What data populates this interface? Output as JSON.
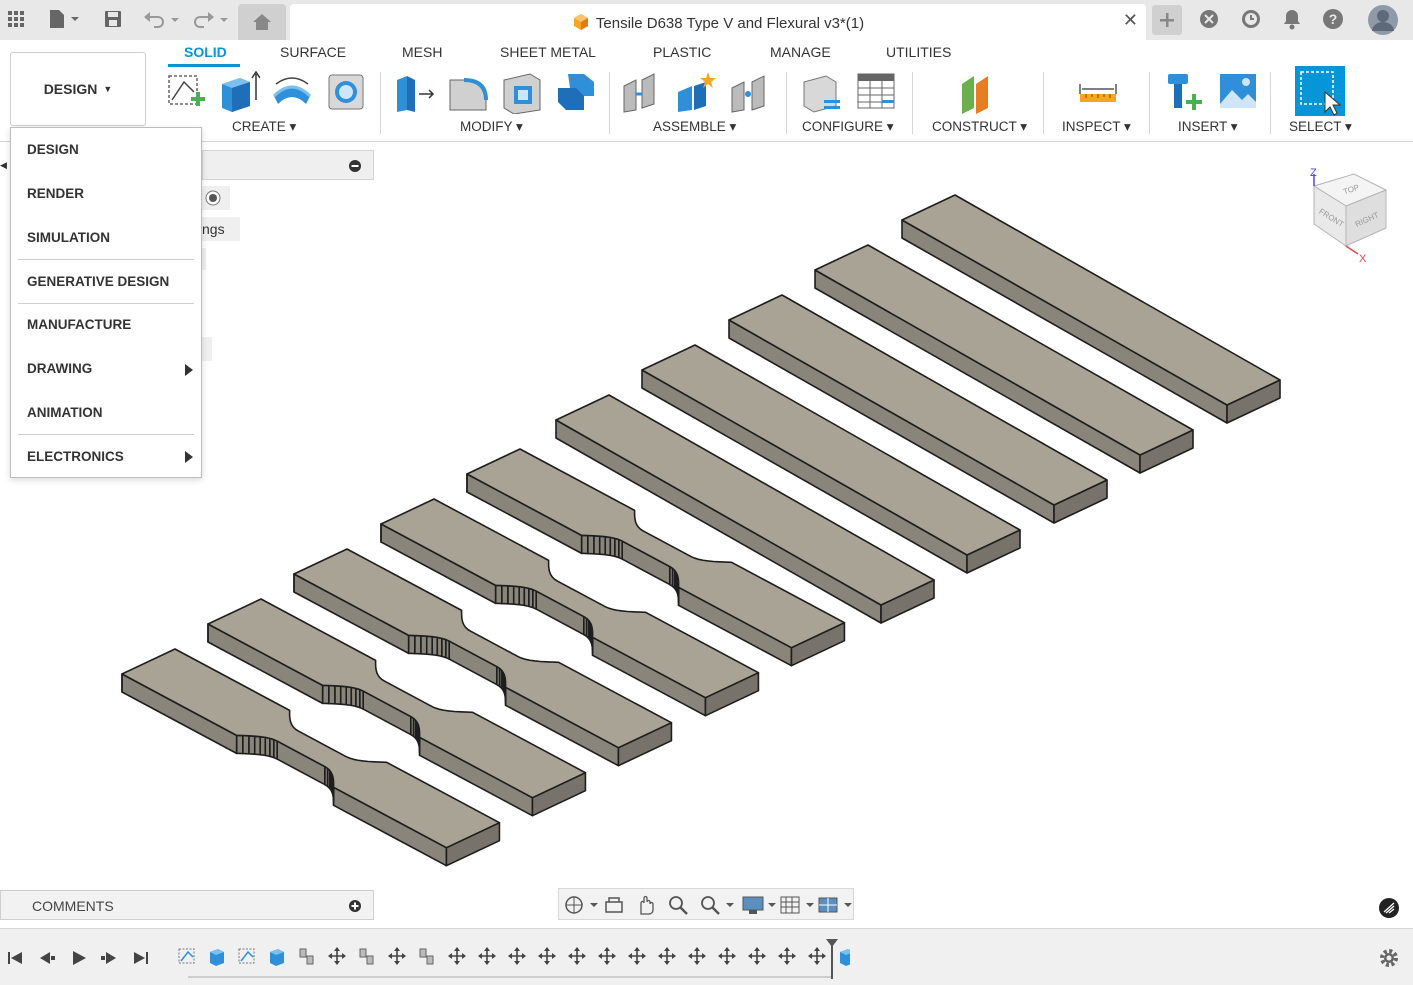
{
  "document": {
    "title": "Tensile D638 Type V and Flexural v3*(1)"
  },
  "workspace": {
    "button_label": "DESIGN"
  },
  "tabs": [
    {
      "label": "SOLID",
      "active": true
    },
    {
      "label": "SURFACE"
    },
    {
      "label": "MESH"
    },
    {
      "label": "SHEET METAL"
    },
    {
      "label": "PLASTIC"
    },
    {
      "label": "MANAGE"
    },
    {
      "label": "UTILITIES"
    }
  ],
  "groups": [
    {
      "label": "CREATE"
    },
    {
      "label": "MODIFY"
    },
    {
      "label": "ASSEMBLE"
    },
    {
      "label": "CONFIGURE"
    },
    {
      "label": "CONSTRUCT"
    },
    {
      "label": "INSPECT"
    },
    {
      "label": "INSERT"
    },
    {
      "label": "SELECT"
    }
  ],
  "workspace_menu": {
    "items": [
      {
        "label": "DESIGN"
      },
      {
        "label": "RENDER"
      },
      {
        "label": "SIMULATION"
      },
      {
        "label": "GENERATIVE DESIGN"
      },
      {
        "label": "MANUFACTURE"
      },
      {
        "label": "DRAWING"
      },
      {
        "label": "ANIMATION"
      },
      {
        "label": "ELECTRONICS"
      }
    ]
  },
  "browser": {
    "partial_text": "ngs"
  },
  "viewcube": {
    "top": "TOP",
    "front": "FRONT",
    "right": "RIGHT",
    "z_axis": "Z",
    "x_axis": "X"
  },
  "comments": {
    "label": "COMMENTS"
  },
  "colors": {
    "accent": "#0696d7",
    "part_top": "#a9a396",
    "part_side": "#8a857a",
    "part_front": "#77736a"
  }
}
